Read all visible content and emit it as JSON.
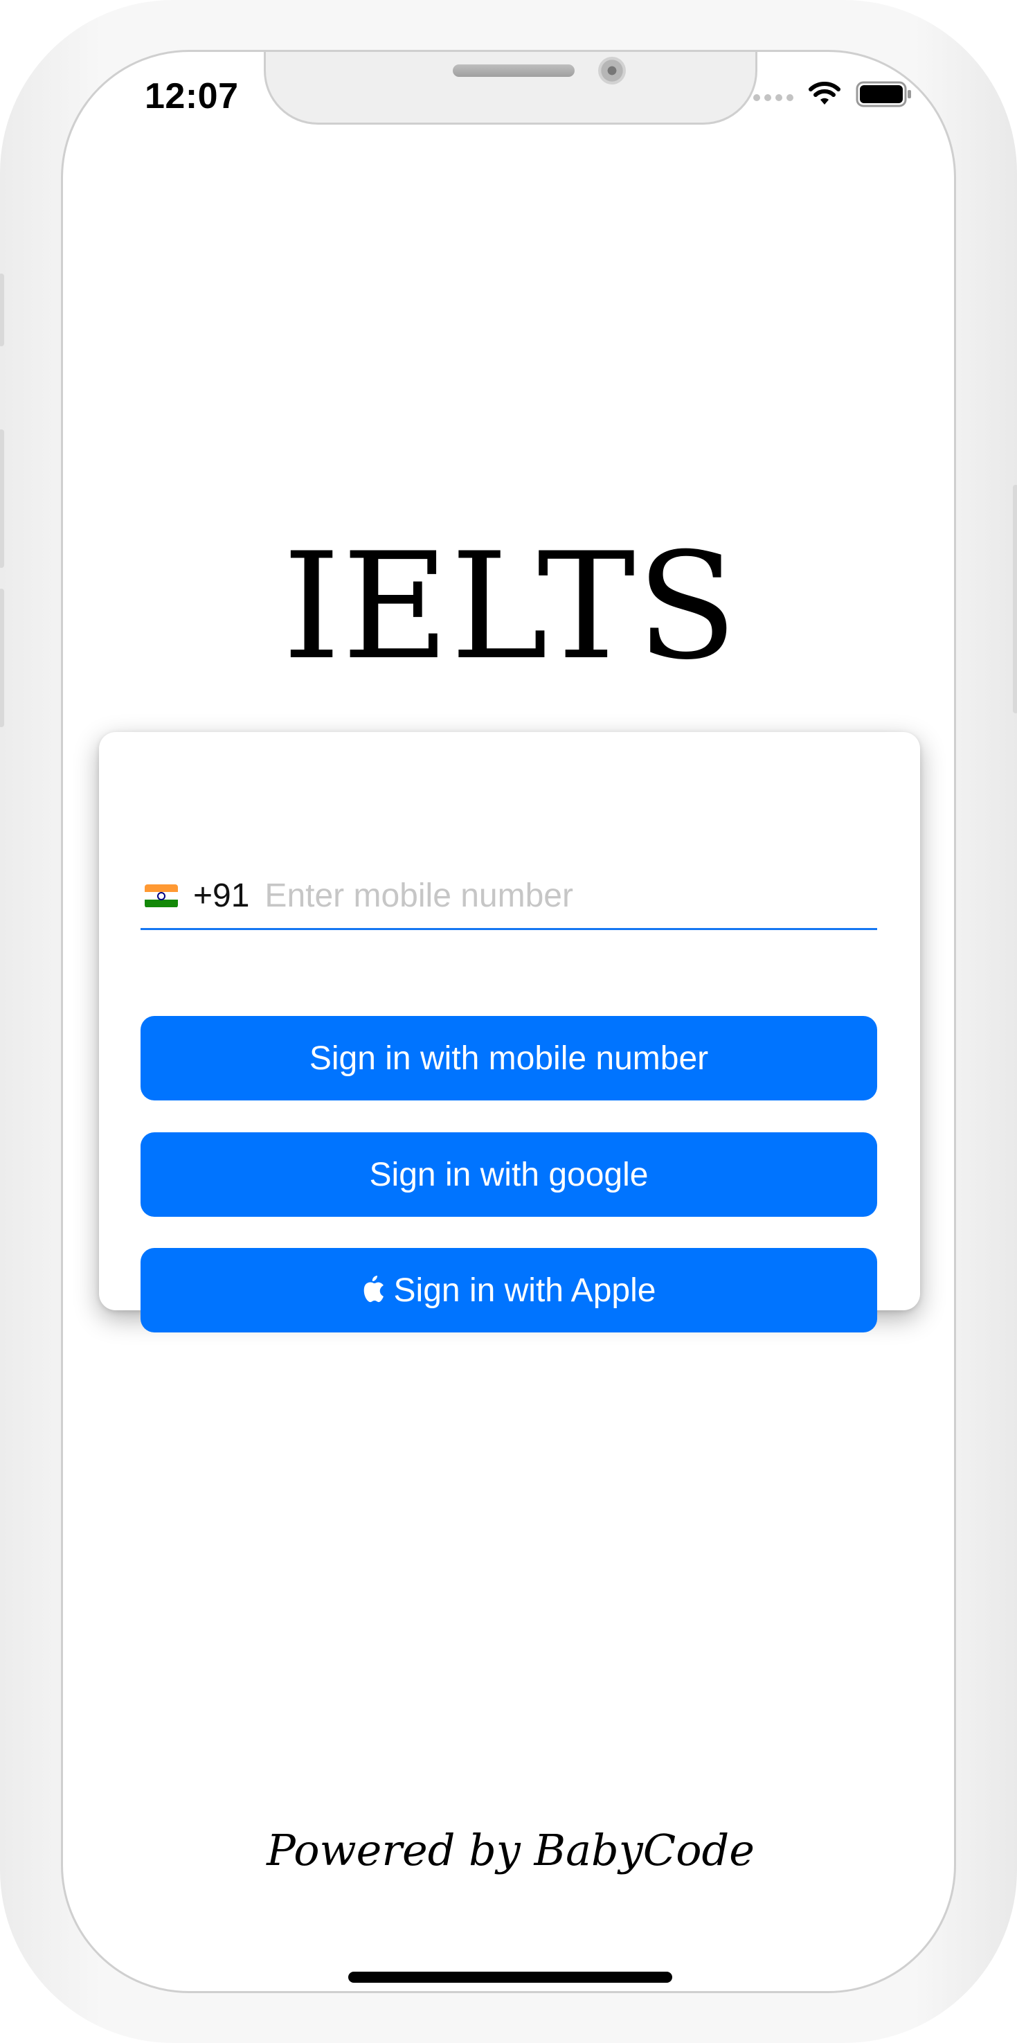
{
  "status_bar": {
    "time": "12:07"
  },
  "app": {
    "title": "IELTS"
  },
  "login": {
    "country_flag": "india-flag-icon",
    "country_code": "+91",
    "mobile_value": "",
    "mobile_placeholder": "Enter mobile number",
    "sign_in_mobile_label": "Sign in with mobile number",
    "sign_in_google_label": "Sign in with google",
    "sign_in_apple_label": "Sign in with Apple"
  },
  "footer": {
    "credit": "Powered by BabyCode"
  },
  "colors": {
    "primary_button": "#0074ff",
    "input_underline": "#1577f2",
    "placeholder": "#c6c6c6",
    "frame": "#f7f7f7"
  },
  "icons": {
    "status_signal": "signal-dots-icon",
    "status_wifi": "wifi-icon",
    "status_battery": "battery-icon",
    "apple": "apple-icon"
  }
}
